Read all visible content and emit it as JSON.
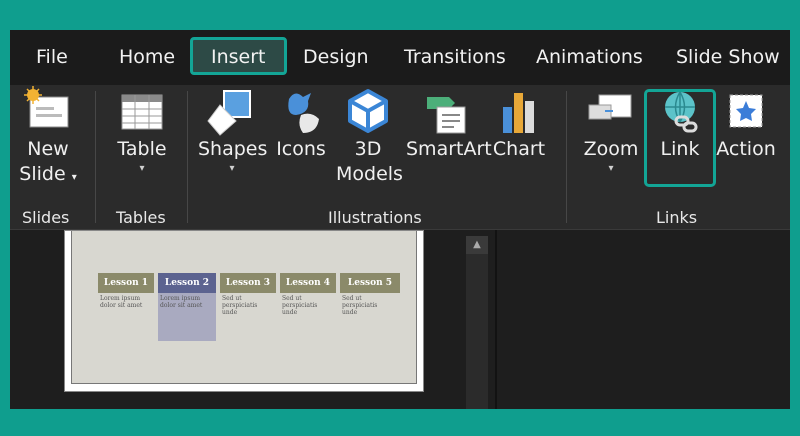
{
  "tabs": [
    {
      "label": "File"
    },
    {
      "label": "Home"
    },
    {
      "label": "Insert"
    },
    {
      "label": "Design"
    },
    {
      "label": "Transitions"
    },
    {
      "label": "Animations"
    },
    {
      "label": "Slide Show"
    }
  ],
  "ribbon": {
    "slides": {
      "new_slide_line1": "New",
      "new_slide_line2": "Slide",
      "group": "Slides"
    },
    "tables": {
      "table": "Table",
      "group": "Tables"
    },
    "illustrations": {
      "shapes": "Shapes",
      "icons": "Icons",
      "models_line1": "3D",
      "models_line2": "Models",
      "smartart": "SmartArt",
      "chart": "Chart",
      "group": "Illustrations"
    },
    "links": {
      "zoom": "Zoom",
      "link": "Link",
      "action": "Action",
      "group": "Links"
    }
  },
  "slide": {
    "lessons": [
      "Lesson 1",
      "Lesson 2",
      "Lesson 3",
      "Lesson 4",
      "Lesson 5"
    ],
    "bodies": [
      "Lorem ipsum dolor sit amet",
      "Lorem ipsum dolor sit amet",
      "Sed ut perspiciatis unde",
      "Sed ut perspiciatis unde",
      "Sed ut perspiciatis unde"
    ]
  },
  "colors": {
    "accent": "#13a596",
    "lesson_olive": "#8b8a6a",
    "lesson_blue": "#5c6390"
  }
}
